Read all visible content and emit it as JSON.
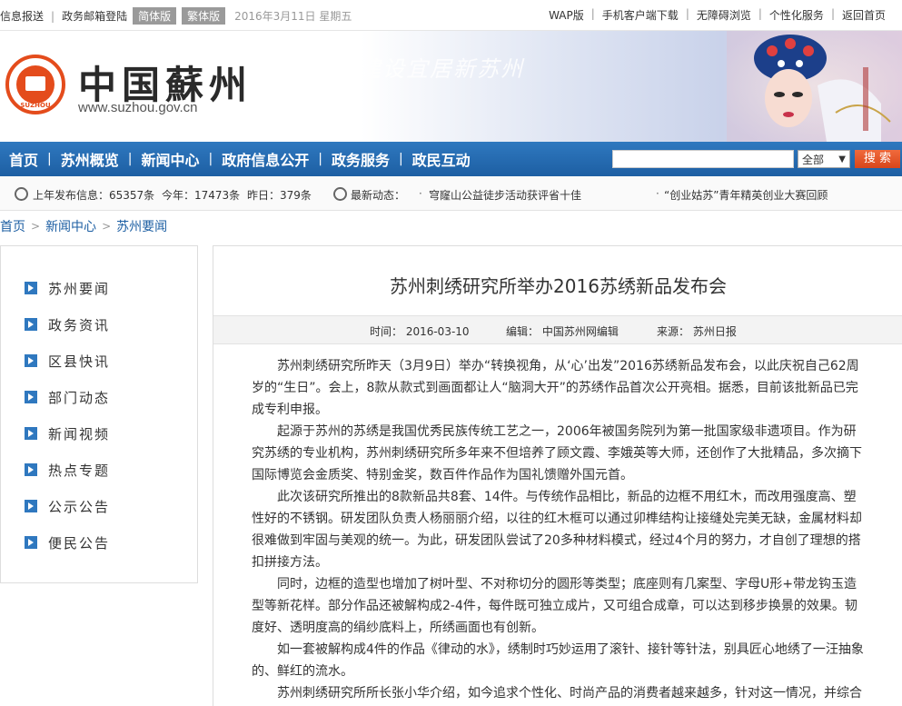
{
  "topbar": {
    "left_links": [
      "信息报送",
      "政务邮箱登陆"
    ],
    "lang_simplified": "简体版",
    "lang_traditional": "繁体版",
    "date": "2016年3月11日 星期五",
    "right_links": [
      "WAP版",
      "手机客户端下载",
      "无障碍浏览",
      "个性化服务",
      "返回首页"
    ]
  },
  "banner": {
    "site_name": "中国蘇州",
    "site_url": "www.suzhou.gov.cn",
    "slogan": "建设宜居新苏州",
    "logo_text": "SUZHOU"
  },
  "nav": {
    "items": [
      "首页",
      "苏州概览",
      "新闻中心",
      "政府信息公开",
      "政务服务",
      "政民互动"
    ],
    "search_placeholder": "",
    "scope": "全部",
    "search_button": "搜 索"
  },
  "stats": {
    "last_year": "上年发布信息：65357条",
    "this_year": "今年：17473条",
    "yesterday": "昨日：379条",
    "latest_label": "最新动态：",
    "news1": "穹窿山公益徒步活动获评省十佳",
    "news2": "“创业姑苏”青年精英创业大赛回顾"
  },
  "breadcrumb": [
    "首页",
    "新闻中心",
    "苏州要闻"
  ],
  "sidebar": {
    "items": [
      "苏州要闻",
      "政务资讯",
      "区县快讯",
      "部门动态",
      "新闻视频",
      "热点专题",
      "公示公告",
      "便民公告"
    ]
  },
  "article": {
    "title": "苏州刺绣研究所举办2016苏绣新品发布会",
    "time": "时间： 2016-03-10",
    "editor": "编辑： 中国苏州网编辑",
    "source": "来源： 苏州日报",
    "paragraphs": [
      "苏州刺绣研究所昨天（3月9日）举办“转换视角，从‘心’出发”2016苏绣新品发布会，以此庆祝自己62周岁的“生日”。会上，8款从款式到画面都让人“脑洞大开”的苏绣作品首次公开亮相。据悉，目前该批新品已完成专利申报。",
      "起源于苏州的苏绣是我国优秀民族传统工艺之一，2006年被国务院列为第一批国家级非遗项目。作为研究苏绣的专业机构，苏州刺绣研究所多年来不但培养了顾文霞、李娥英等大师，还创作了大批精品，多次摘下国际博览会金质奖、特别金奖，数百件作品作为国礼馈赠外国元首。",
      "此次该研究所推出的8款新品共8套、14件。与传统作品相比，新品的边框不用红木，而改用强度高、塑性好的不锈钢。研发团队负责人杨丽丽介绍，以往的红木框可以通过卯榫结构让接缝处完美无缺，金属材料却很难做到牢固与美观的统一。为此，研发团队尝试了20多种材料模式，经过4个月的努力，才自创了理想的搭扣拼接方法。",
      "同时，边框的造型也增加了树叶型、不对称切分的圆形等类型；底座则有几案型、字母U形+带龙钩玉造型等新花样。部分作品还被解构成2-4件，每件既可独立成片，又可组合成章，可以达到移步换景的效果。韧度好、透明度高的绢纱底料上，所绣画面也有创新。",
      "如一套被解构成4件的作品《律动的水》，绣制时巧妙运用了滚针、接针等针法，别具匠心地绣了一汪抽象的、鲜红的流水。",
      "苏州刺绣研究所所长张小华介绍，如今追求个性化、时尚产品的消费者越来越多，针对这一情况，并综合"
    ]
  },
  "colors": {
    "nav_blue": "#1d5fa3",
    "search_orange": "#e0521f",
    "logo_red": "#e44c1c"
  }
}
